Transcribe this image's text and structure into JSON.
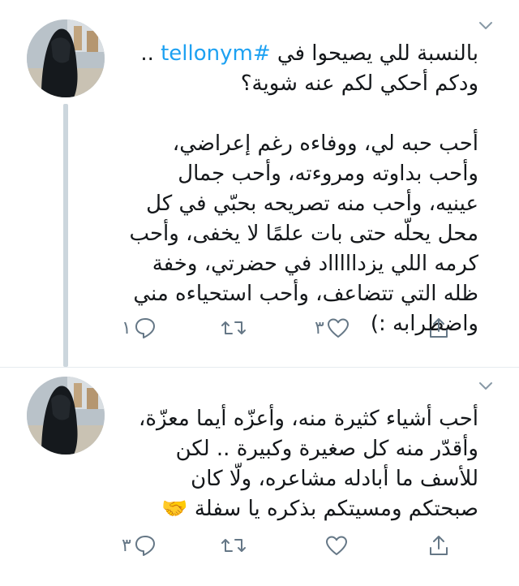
{
  "tweets": [
    {
      "hashtag": "#tellonym",
      "text_before_tag": "بالنسبة للي يصيحوا في ",
      "text_after_tag": " ..\nودكم أحكي لكم عنه شوية؟\n\nأحب حبه لي، ووفاءه رغم إعراضي، وأحب بداوته ومروءته، وأحب جمال عينيه، وأحب منه تصريحه بحبّي في كل محل يحلّه حتى بات علمًا لا يخفى، وأحب كرمه اللي يزداااااد في حضرتي، وخفة ظله التي تتضاعف، وأحب استحياءه مني واضطرابه :)",
      "reply_count": "١",
      "retweet_count": "",
      "like_count": "٣",
      "icons": {
        "reply": "reply-icon",
        "retweet": "retweet-icon",
        "like": "heart-icon",
        "share": "share-icon",
        "caret": "chevron-down-icon"
      }
    },
    {
      "text": "أحب أشياء كثيرة منه، وأعزّه أيما معزّة، وأقدّر منه كل صغيرة وكبيرة .. لكن للأسف ما أبادله مشاعره، ولّا كان صبحتكم ومسيتكم بذكره يا سفلة 🤝",
      "reply_count": "٣",
      "retweet_count": "",
      "like_count": "",
      "icons": {
        "reply": "reply-icon",
        "retweet": "retweet-icon",
        "like": "heart-icon",
        "share": "share-icon",
        "caret": "chevron-down-icon"
      }
    }
  ],
  "colors": {
    "text": "#14171a",
    "hashtag": "#1da1f2",
    "icon": "#657786",
    "thread_line": "#ccd6dd",
    "separator": "#e6ecf0"
  }
}
